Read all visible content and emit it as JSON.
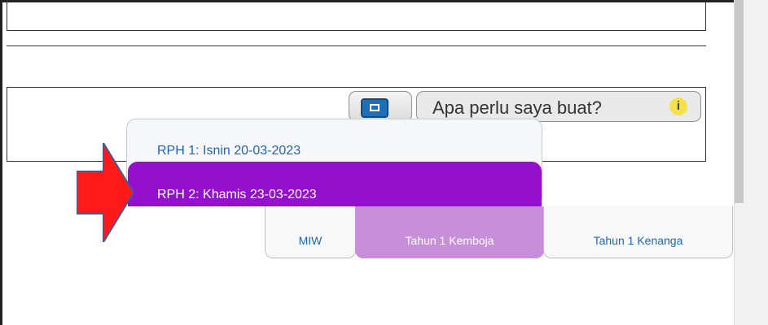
{
  "toolbar": {
    "need_label": "Apa perlu saya buat?",
    "info_badge": "i"
  },
  "dropdown": {
    "items": [
      "RPH 1: Isnin 20-03-2023",
      "RPH 2: Khamis 23-03-2023"
    ],
    "selected_index": 1,
    "selected_color": "#9410cc"
  },
  "tabs": [
    {
      "label": "MIW"
    },
    {
      "label": "Tahun 1 Kemboja",
      "active": true
    },
    {
      "label": "Tahun 1 Kenanga"
    }
  ],
  "colors": {
    "tab_active": "#c78fd9",
    "link_blue": "#1f64b4",
    "arrow_red": "#ff1a1a",
    "info_badge": "#f7e14a"
  },
  "icons": {
    "help_button": "presentation-icon",
    "annotation": "red-arrow-icon"
  }
}
